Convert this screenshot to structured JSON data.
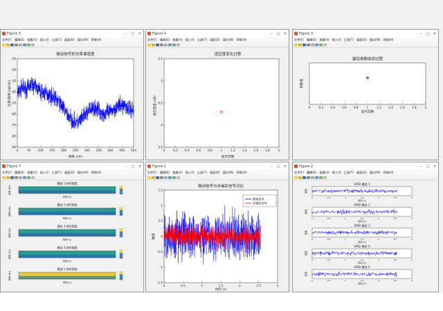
{
  "menus": [
    "文件(F)",
    "编辑(E)",
    "查看(V)",
    "插入(I)",
    "工具(T)",
    "桌面(D)",
    "窗口(W)",
    "帮助(H)"
  ],
  "windows": {
    "w1": {
      "title": "Figure 5"
    },
    "w2": {
      "title": "Figure 4"
    },
    "w3": {
      "title": "Figure 3"
    },
    "w4": {
      "title": "Figure 7"
    },
    "w5": {
      "title": "Figure 1"
    },
    "w6": {
      "title": "Figure 2"
    }
  },
  "chart_data": [
    {
      "type": "line",
      "title": "振动信号的功率谱密度",
      "xlabel": "频率 (Hz)",
      "ylabel": "功率/频率 (dB/Hz)",
      "xlim": [
        0,
        500
      ],
      "ylim": [
        -90,
        -10
      ],
      "xticks": [
        "0",
        "50",
        "100",
        "150",
        "200",
        "250",
        "300",
        "350",
        "400",
        "450",
        "500"
      ],
      "yticks": [
        "-10",
        "-20",
        "-30",
        "-40",
        "-50",
        "-60",
        "-70",
        "-80",
        "-90"
      ],
      "color": "#0000ff",
      "trend": [
        [
          0,
          -42
        ],
        [
          20,
          -36
        ],
        [
          40,
          -38
        ],
        [
          60,
          -33
        ],
        [
          80,
          -35
        ],
        [
          100,
          -40
        ],
        [
          130,
          -42
        ],
        [
          160,
          -45
        ],
        [
          190,
          -52
        ],
        [
          220,
          -62
        ],
        [
          240,
          -66
        ],
        [
          260,
          -68
        ],
        [
          280,
          -64
        ],
        [
          310,
          -56
        ],
        [
          340,
          -55
        ],
        [
          370,
          -60
        ],
        [
          400,
          -58
        ],
        [
          430,
          -53
        ],
        [
          460,
          -52
        ],
        [
          490,
          -56
        ]
      ]
    },
    {
      "type": "scatter",
      "title": "适应度变化过程",
      "xlabel": "迭代次数",
      "ylabel": "适应度值 (dB)",
      "xlim": [
        0,
        2
      ],
      "ylim": [
        3.5,
        5.5
      ],
      "xticks": [
        "0",
        "0.2",
        "0.4",
        "0.6",
        "0.8",
        "1",
        "1.2",
        "1.4",
        "1.6",
        "1.8",
        "2"
      ],
      "yticks": [
        "5.5",
        "5",
        "4.5",
        "4",
        "3.5"
      ],
      "points": [
        {
          "x": 1,
          "y": 4.3
        }
      ],
      "color": "#d9252b"
    },
    {
      "type": "scatter",
      "title": "最佳参数收敛过程",
      "xlabel": "迭代次数",
      "ylabel": "参数值",
      "xlim": [
        0,
        2
      ],
      "xticks": [
        "0",
        "0.2",
        "0.4",
        "0.6",
        "0.8",
        "1",
        "1.2",
        "1.4",
        "1.6",
        "1.8",
        "2"
      ],
      "points": [
        {
          "x": 1
        }
      ],
      "color": "#0000c0"
    },
    {
      "type": "heatmap",
      "panels": [
        {
          "title": "模态 1 的时频图",
          "xlabel": "时间 (s)",
          "ylabel": "频率 (Hz)"
        },
        {
          "title": "模态 2 的时频图",
          "xlabel": "时间 (s)",
          "ylabel": "频率 (Hz)"
        },
        {
          "title": "模态 3 的时频图",
          "xlabel": "时间 (s)",
          "ylabel": "频率 (Hz)"
        },
        {
          "title": "模态 4 的时频图",
          "xlabel": "时间 (s)",
          "ylabel": "频率 (Hz)"
        },
        {
          "title": "模态 5 的时频图",
          "xlabel": "时间 (s)",
          "ylabel": "频率 (Hz)"
        }
      ]
    },
    {
      "type": "line",
      "title": "振动信号与去噪后信号对比",
      "xlabel": "时间 (s)",
      "ylabel": "幅值",
      "xlim": [
        0,
        3
      ],
      "ylim": [
        -1.5,
        1.5
      ],
      "xticks": [
        "0",
        "0.5",
        "1",
        "1.5",
        "2",
        "2.5",
        "3"
      ],
      "yticks": [
        "1.5",
        "1",
        "0.5",
        "0",
        "-0.5",
        "-1",
        "-1.5"
      ],
      "series": [
        {
          "name": "原始信号",
          "color": "#0000ff",
          "amplitude": 1.0,
          "x_end": 2.55
        },
        {
          "name": "去噪后信号",
          "color": "#ff0000",
          "amplitude": 0.45,
          "x_end": 2.55
        }
      ]
    },
    {
      "type": "line",
      "panels": [
        {
          "title": "VMD 模态 1",
          "xlabel": "时间 (s)",
          "ylabel": "幅值"
        },
        {
          "title": "VMD 模态 2",
          "xlabel": "时间 (s)",
          "ylabel": "幅值"
        },
        {
          "title": "VMD 模态 3",
          "xlabel": "时间 (s)",
          "ylabel": "幅值"
        },
        {
          "title": "VMD 模态 4",
          "xlabel": "时间 (s)",
          "ylabel": "幅值"
        },
        {
          "title": "VMD 模态 5",
          "xlabel": "时间 (s)",
          "ylabel": "幅值"
        }
      ],
      "xticks": [
        "0",
        "0.5",
        "1",
        "1.5",
        "2",
        "2.5",
        "3"
      ],
      "color": "#0000ff"
    }
  ]
}
